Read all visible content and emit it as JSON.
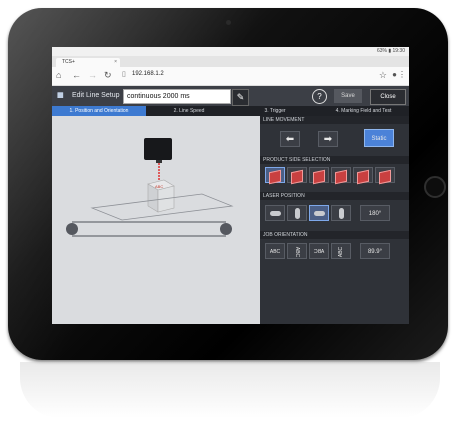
{
  "statusbar": {
    "text": "63% ▮ 19:30"
  },
  "browser": {
    "tab_title": "TCS+",
    "url": "192.168.1.2"
  },
  "app": {
    "title": "Edit Line Setup",
    "mode_value": "continuous 2000 ms",
    "help_label": "?",
    "save_label": "Save",
    "close_label": "Close"
  },
  "steps": [
    {
      "label": "1. Position and Orientation"
    },
    {
      "label": "2. Line Speed"
    },
    {
      "label": "3. Trigger"
    },
    {
      "label": "4. Marking Field and Test"
    }
  ],
  "panel": {
    "line_movement_title": "LINE MOVEMENT",
    "static_label": "Static",
    "product_side_title": "PRODUCT SIDE SELECTION",
    "laser_position_title": "LASER POSITION",
    "laser_angle": "180°",
    "job_orientation_title": "JOB ORIENTATION",
    "job_angle": "89.9°",
    "orientation_labels": [
      "ABC",
      "ABC",
      "ABC",
      "ABC"
    ]
  },
  "colors": {
    "accent": "#3d7ad1",
    "header": "#3c3f46",
    "panel": "#2f3238"
  }
}
